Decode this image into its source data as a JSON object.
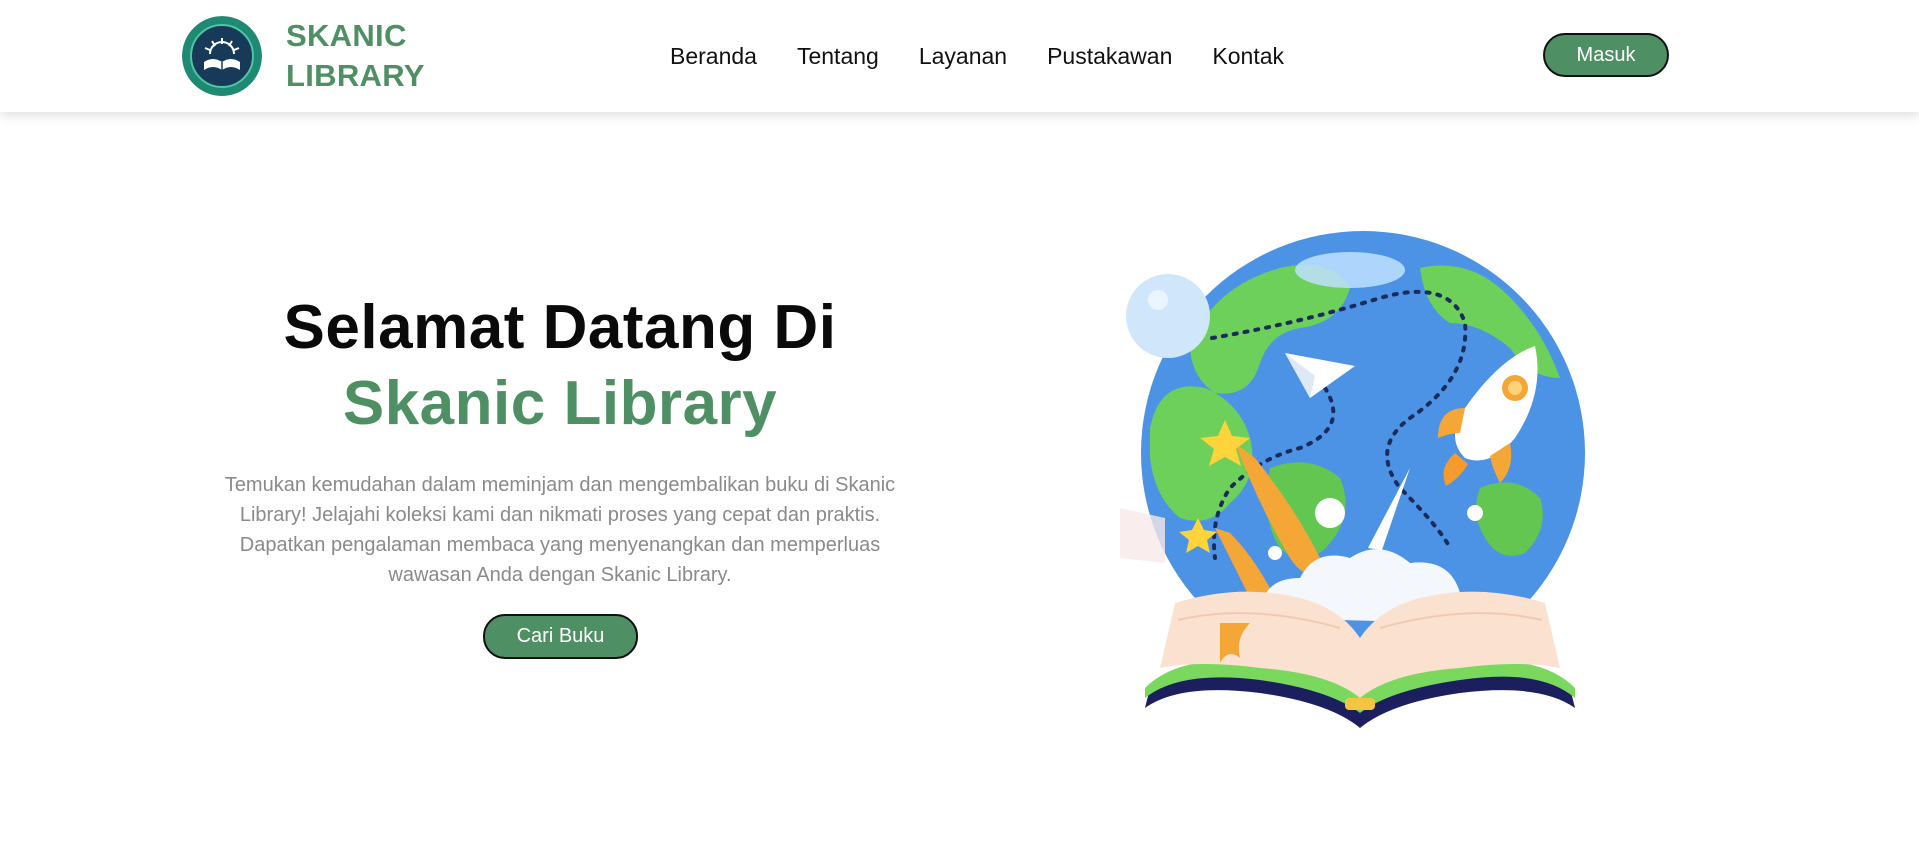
{
  "brand": {
    "name_line1": "SKANIC",
    "name_line2": "LIBRARY",
    "logo_icon": "library-book-logo-icon"
  },
  "nav": {
    "items": [
      {
        "label": "Beranda"
      },
      {
        "label": "Tentang"
      },
      {
        "label": "Layanan"
      },
      {
        "label": "Pustakawan"
      },
      {
        "label": "Kontak"
      }
    ],
    "login_label": "Masuk"
  },
  "hero": {
    "title_line1": "Selamat Datang Di",
    "title_line2": "Skanic Library",
    "description": "Temukan kemudahan dalam meminjam dan mengembalikan buku di Skanic Library! Jelajahi koleksi kami dan nikmati proses yang cepat dan praktis. Dapatkan pengalaman membaca yang menyenangkan dan memperluas wawasan Anda dengan Skanic Library.",
    "cta_label": "Cari Buku",
    "illustration": "globe-open-book-illustration"
  },
  "colors": {
    "accent": "#4e8f63",
    "text_dark": "#0a0a0a",
    "text_muted": "#8a8a8a"
  }
}
